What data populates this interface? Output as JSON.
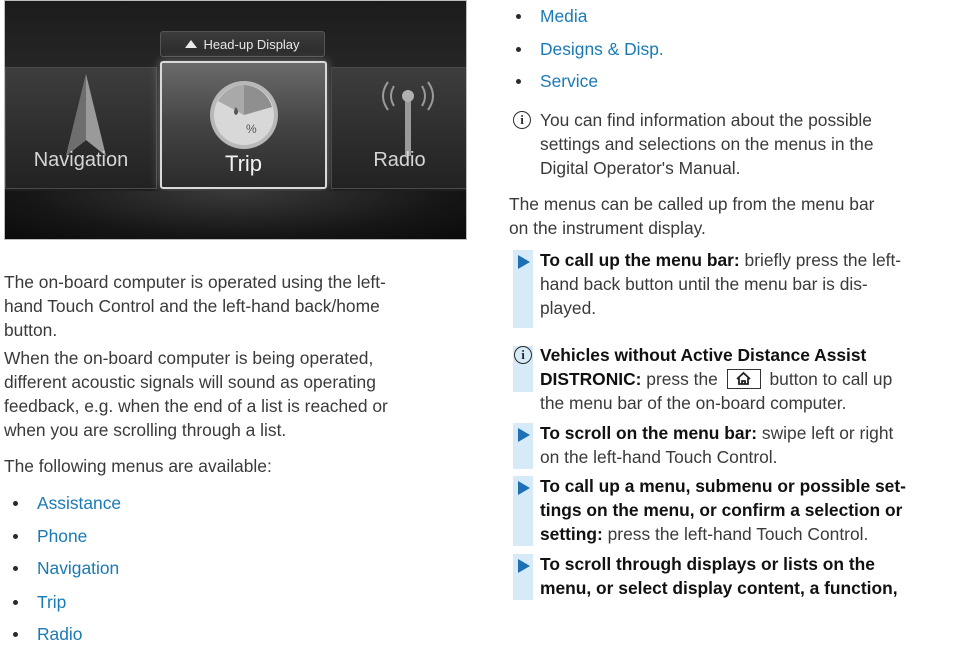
{
  "screen": {
    "hud_label": "Head-up Display",
    "tiles": {
      "navigation": "Navigation",
      "trip": "Trip",
      "radio": "Radio"
    },
    "trip_icon_pct": "%"
  },
  "left": {
    "para1": "The on-board computer is operated using the left-hand Touch Control and the left-hand back/home button.",
    "para1_lines": [
      "The on-board computer is operated using the left-",
      "hand Touch Control and the left-hand back/home",
      "button."
    ],
    "para2_lines": [
      "When the on-board computer is being operated,",
      "different acoustic signals will sound as operating",
      "feedback, e.g. when the end of a list is reached or",
      "when you are scrolling through a list."
    ],
    "para3": "The following menus are available:",
    "menus": [
      "Assistance",
      "Phone",
      "Navigation",
      "Trip",
      "Radio"
    ]
  },
  "right": {
    "menus": [
      "Media",
      "Designs & Disp.",
      "Service"
    ],
    "info1_lines": [
      "You can find information about the possible",
      "settings and selections on the menus in the",
      "Digital Operator's Manual."
    ],
    "para1_lines": [
      "The menus can be called up from the menu bar",
      "on the instrument display."
    ],
    "step1_bold": "To call up the menu bar:",
    "step1_lines": [
      " briefly press the left-",
      "hand back button until the menu bar is dis-",
      "played."
    ],
    "info2_bold_lines": [
      "Vehicles without Active Distance Assist",
      "DISTRONIC:"
    ],
    "info2_a": " press the ",
    "info2_b": " button to call up",
    "info2_c": "the menu bar of the on-board computer.",
    "step2_bold": "To scroll on the menu bar:",
    "step2_rest": " swipe left or right",
    "step2_line2": "on the left-hand Touch Control.",
    "step3_bold_lines": [
      "To call up a menu, submenu or possible set-",
      "tings on the menu, or confirm a selection or",
      "setting:"
    ],
    "step3_rest": " press the left-hand Touch Control.",
    "step4_bold_lines": [
      "To scroll through displays or lists on the",
      "menu, or select display content, a function,"
    ]
  }
}
